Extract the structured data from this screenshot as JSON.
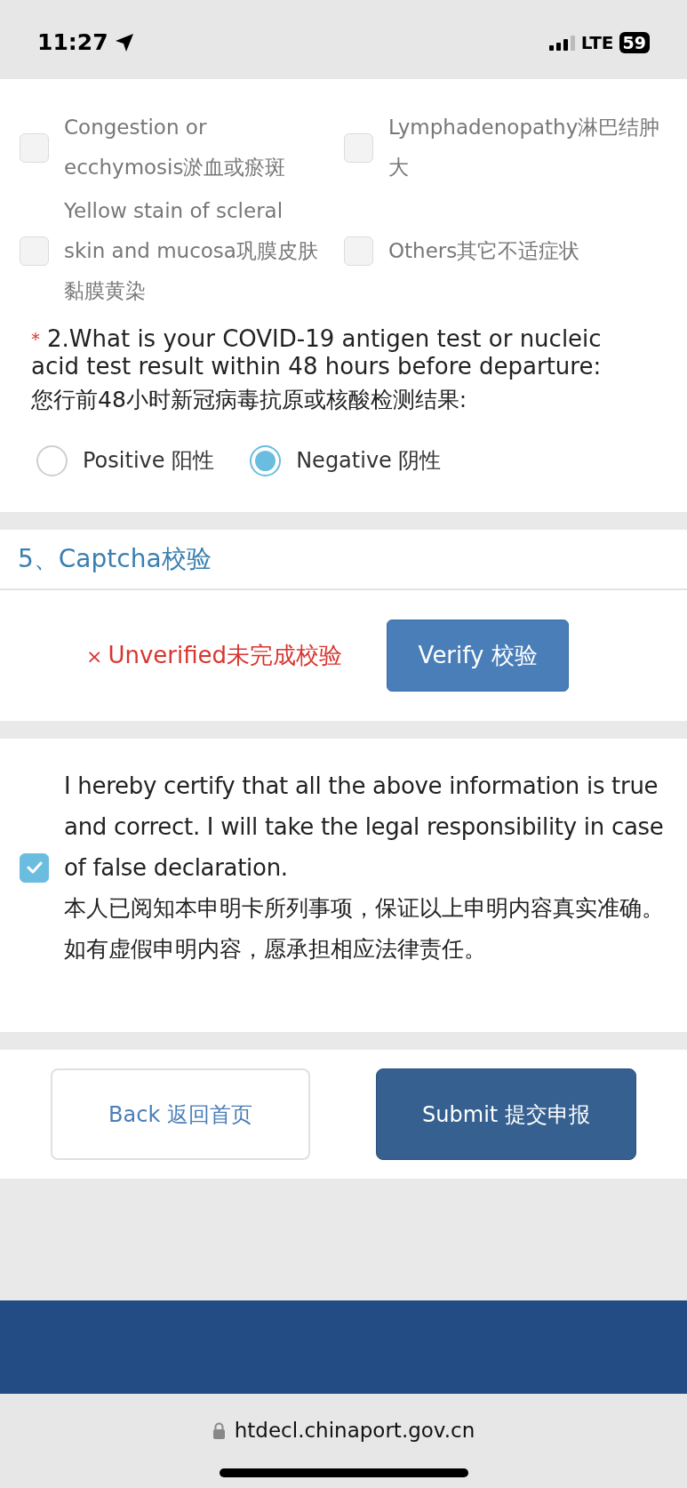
{
  "status_bar": {
    "time": "11:27",
    "network": "LTE",
    "battery": "59"
  },
  "symptoms": [
    {
      "label": "Congestion or ecchymosis淤血或瘀斑",
      "checked": false
    },
    {
      "label": "Lymphadenopathy淋巴结肿大",
      "checked": false
    },
    {
      "label": "Yellow stain of scleral skin and mucosa巩膜皮肤黏膜黄染",
      "checked": false
    },
    {
      "label": "Others其它不适症状",
      "checked": false
    }
  ],
  "question": {
    "required_mark": "*",
    "text": "2.What is your COVID-19 antigen test or nucleic acid test result within 48 hours before departure:",
    "text_zh": "您行前48小时新冠病毒抗原或核酸检测结果:",
    "options": [
      {
        "label": "Positive 阳性",
        "selected": false
      },
      {
        "label": "Negative 阴性",
        "selected": true
      }
    ]
  },
  "captcha": {
    "title": "5、Captcha校验",
    "status_icon": "×",
    "status": "Unverified未完成校验",
    "verify_button": "Verify 校验"
  },
  "declaration": {
    "checked": true,
    "text": "I hereby certify that all the above information is true and correct. I will take the legal responsibility in case of false declaration.",
    "text_zh": "本人已阅知本申明卡所列事项，保证以上申明内容真实准确。如有虚假申明内容，愿承担相应法律责任。"
  },
  "buttons": {
    "back": "Back 返回首页",
    "submit": "Submit 提交申报"
  },
  "address_bar": {
    "url": "htdecl.chinaport.gov.cn"
  }
}
